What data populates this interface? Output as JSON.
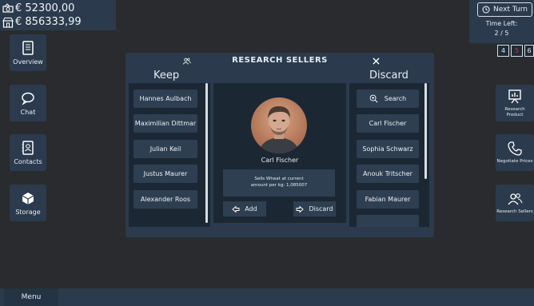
{
  "money": {
    "cash": "€ 52300,00",
    "assets": "€ 856333,99"
  },
  "nav": [
    {
      "label": "Overview",
      "icon": "document-icon"
    },
    {
      "label": "Chat",
      "icon": "chat-bubble-icon"
    },
    {
      "label": "Contacts",
      "icon": "contacts-icon"
    },
    {
      "label": "Storage",
      "icon": "storage-box-icon"
    }
  ],
  "turn": {
    "next_label": "Next Turn",
    "time_left_label": "Time Left:",
    "time_left_value": "2 / 5"
  },
  "pager": [
    "4",
    "5",
    "6"
  ],
  "tools": [
    {
      "label": "Research Product",
      "icon": "chart-board-icon"
    },
    {
      "label": "Negotiate Prices",
      "icon": "phone-icon"
    },
    {
      "label": "Research Sellers",
      "icon": "people-icon"
    }
  ],
  "menu_label": "Menu",
  "dialog": {
    "title": "RESEARCH SELLERS",
    "keep_label": "Keep",
    "discard_label": "Discard",
    "keep_list": [
      "Hannes Aulbach",
      "Maximilian Dittmar",
      "Julian Keil",
      "Justus Maurer",
      "Alexander Roos"
    ],
    "discard_search": "Search",
    "discard_list": [
      "Carl Fischer",
      "Sophia Schwarz",
      "Anouk Tritscher",
      "Fabian Maurer"
    ],
    "seller": {
      "name": "Carl Fischer",
      "info_line1": "Sells Wheat at current",
      "info_line2": "amount per kg: 1,085007"
    },
    "add_label": "Add",
    "discard_button": "Discard"
  },
  "colors": {
    "panel": "#2b3b4d",
    "dark": "#1c2734",
    "item": "#2e3f52",
    "accent_red": "#d23a3a"
  }
}
